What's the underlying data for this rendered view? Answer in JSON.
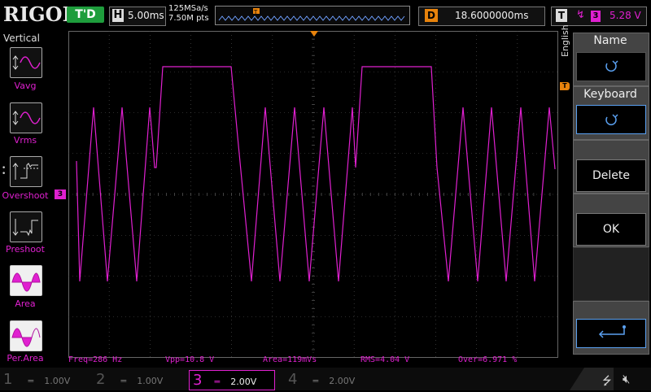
{
  "brand": "RIGOL",
  "run_status": "T'D",
  "horizontal": {
    "key": "H",
    "timebase": "5.00ms"
  },
  "acquisition": {
    "sample_rate": "125MSa/s",
    "memory_depth": "7.50M pts"
  },
  "delay": {
    "key": "D",
    "value": "18.6000000ms"
  },
  "trigger": {
    "key": "T",
    "source_channel": "3",
    "level": "5.28 V"
  },
  "left_menu": {
    "title": "Vertical",
    "items": [
      {
        "label": "Vavg",
        "icon": "vavg-icon",
        "highlight": false
      },
      {
        "label": "Vrms",
        "icon": "vrms-icon",
        "highlight": false
      },
      {
        "label": "Overshoot",
        "icon": "overshoot-icon",
        "highlight": false
      },
      {
        "label": "Preshoot",
        "icon": "preshoot-icon",
        "highlight": false
      },
      {
        "label": "Area",
        "icon": "area-icon",
        "highlight": true
      },
      {
        "label": "Per.Area",
        "icon": "per-area-icon",
        "highlight": true
      }
    ]
  },
  "right_menu": {
    "language": "English",
    "items": [
      {
        "label": "Name"
      },
      {
        "label": "Keyboard"
      },
      {
        "label": "Delete"
      },
      {
        "label": "OK"
      }
    ]
  },
  "measurements": [
    "Freq=286 Hz",
    "Vpp=10.8 V",
    "Area=119mVs",
    "RMS=4.04 V",
    "Over=6.971 %"
  ],
  "channels": [
    {
      "num": "1",
      "scale": "1.00V",
      "active": false
    },
    {
      "num": "2",
      "scale": "1.00V",
      "active": false
    },
    {
      "num": "3",
      "scale": "2.00V",
      "active": true
    },
    {
      "num": "4",
      "scale": "2.00V",
      "active": false
    }
  ],
  "colors": {
    "ch3": "#e020d0",
    "trigger_marker": "#e8830c",
    "run_status_bg": "#1e9d3c",
    "ch3_marker": "#e020d0"
  },
  "trace_markers": {
    "ch3_ground": "3",
    "trigger_level": "T"
  }
}
